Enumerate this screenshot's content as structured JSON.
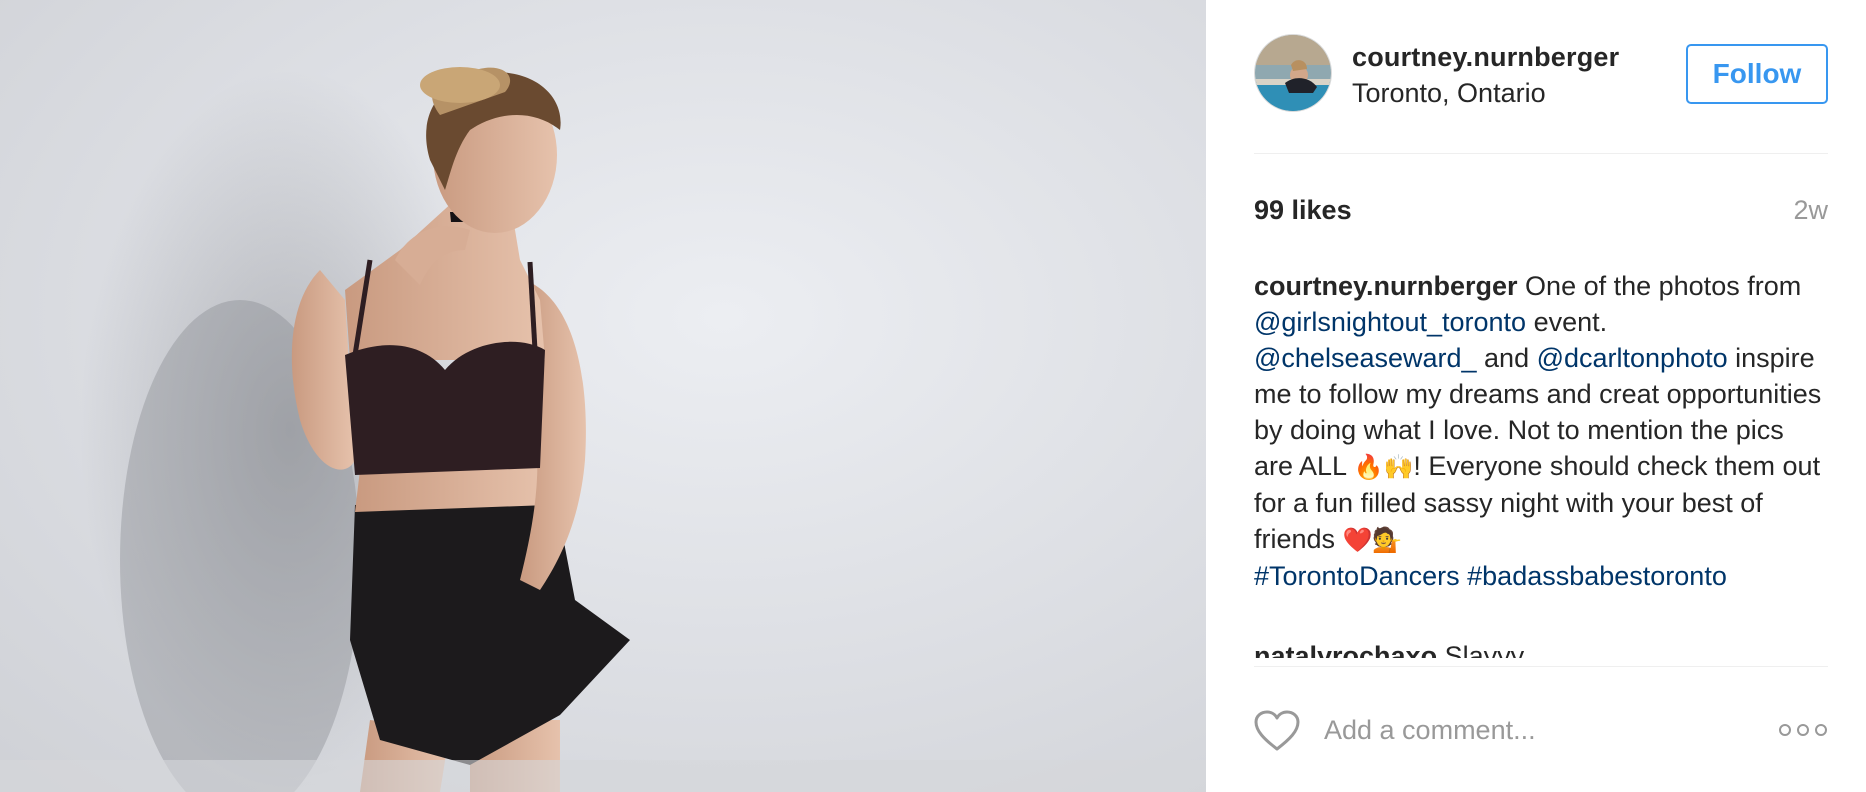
{
  "post": {
    "username": "courtney.nurnberger",
    "location": "Toronto, Ontario",
    "follow_label": "Follow",
    "likes": "99 likes",
    "age": "2w",
    "caption": {
      "username": "courtney.nurnberger",
      "text_1": " One of the photos from ",
      "mention_1": "@girlsnightout_toronto",
      "text_2": " event. ",
      "mention_2": "@chelseaseward_",
      "text_3": " and ",
      "mention_3": "@dcarltonphoto",
      "text_4": " inspire me to follow my dreams and creat opportunities by doing what I love. Not to mention the pics are ALL ",
      "emoji_1": "🔥🙌",
      "text_5": "! Everyone should check them out for a fun filled sassy night with your best of friends ",
      "emoji_2": "❤️💁",
      "hashtag_1": "#TorontoDancers",
      "hashtag_2": "#badassbabestoronto"
    },
    "comment": {
      "username": "natalyrochaxo",
      "text": " Slayyy"
    },
    "comment_placeholder": "Add a comment..."
  },
  "colors": {
    "accent": "#3897f0",
    "link": "#003569",
    "muted": "#999999",
    "text": "#262626"
  },
  "icons": {
    "like": "heart-outline-icon",
    "more": "more-dots-icon"
  }
}
